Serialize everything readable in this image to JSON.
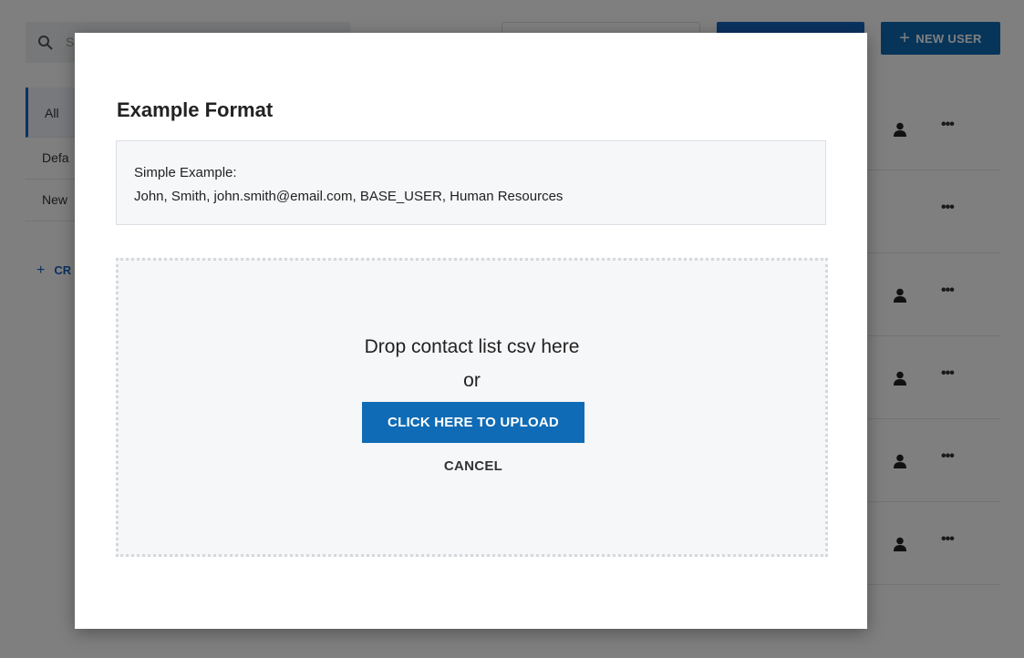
{
  "background": {
    "sidebar": {
      "items": [
        {
          "label": "All"
        },
        {
          "label": "Defa"
        },
        {
          "label": "New"
        }
      ],
      "create_label": "CR"
    },
    "header": {
      "new_user_label": "NEW USER"
    }
  },
  "modal": {
    "title": "Example Format",
    "example": {
      "heading": "Simple Example:",
      "text": "John, Smith, john.smith@email.com, BASE_USER, Human Resources"
    },
    "dropzone": {
      "prompt": "Drop contact list csv here",
      "or": "or",
      "upload_label": "CLICK HERE TO UPLOAD",
      "cancel_label": "CANCEL"
    }
  },
  "colors": {
    "primary": "#0f6bb5",
    "overlay": "rgba(0,0,0,0.5)"
  }
}
